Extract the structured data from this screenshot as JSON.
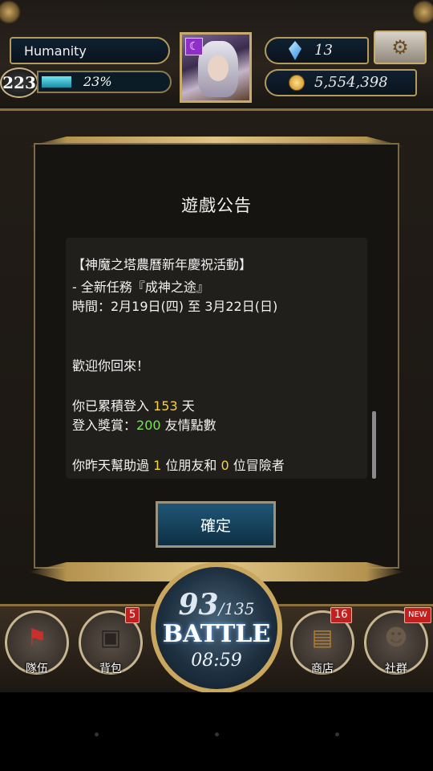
{
  "player": {
    "name": "Humanity",
    "level": "223",
    "xp_percent_text": "23%",
    "xp_fraction": 0.23,
    "avatar_badge_icon": "crescent-moon-icon"
  },
  "currency": {
    "gems": "13",
    "coins": "5,554,398"
  },
  "dialog": {
    "title": "遊戲公告",
    "lines": [
      {
        "prefix": "【神魔之塔農曆新年慶祝活動】"
      },
      {
        "prefix": " - 全新任務『成神之途』"
      },
      {
        "prefix": "時間：2月19日(四) 至 3月22日(日)"
      },
      {
        "prefix": "歡迎你回來！"
      },
      {
        "prefix": "你已累積登入 ",
        "value": "153",
        "suffix": " 天"
      },
      {
        "prefix": "登入獎賞：",
        "value": "200",
        "suffix": " 友情點數"
      },
      {
        "prefix": "你昨天幫助過 ",
        "value": "1",
        "mid": " 位朋友和 ",
        "value2": "0",
        "suffix": " 位冒險者"
      }
    ],
    "confirm_label": "確定"
  },
  "battle": {
    "stamina_current": "93",
    "stamina_max": "/135",
    "label": "BATTLE",
    "timer": "08:59"
  },
  "bottom_nav": {
    "team": {
      "label": "隊伍"
    },
    "bag": {
      "label": "背包",
      "badge": "5"
    },
    "shop": {
      "label": "商店",
      "badge": "16"
    },
    "social": {
      "label": "社群",
      "badge": "NEW"
    }
  },
  "colors": {
    "highlight_yellow": "#f5d33c",
    "highlight_green": "#7fe05c",
    "frame_gold": "#c9ac6c"
  }
}
